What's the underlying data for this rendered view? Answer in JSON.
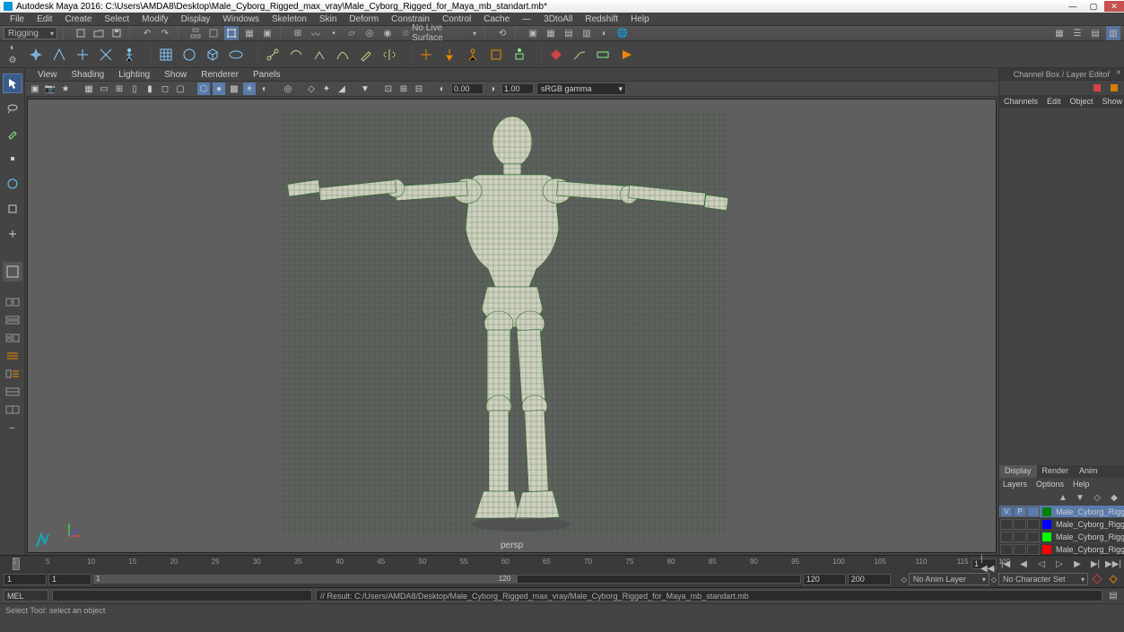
{
  "title": "Autodesk Maya 2016: C:\\Users\\AMDA8\\Desktop\\Male_Cyborg_Rigged_max_vray\\Male_Cyborg_Rigged_for_Maya_mb_standart.mb*",
  "menubar": [
    "File",
    "Edit",
    "Create",
    "Select",
    "Modify",
    "Display",
    "Windows",
    "Skeleton",
    "Skin",
    "Deform",
    "Constrain",
    "Control",
    "Cache",
    "—",
    "3DtoAll",
    "Redshift",
    "Help"
  ],
  "statusline": {
    "workspace": "Rigging",
    "livesurf": "No Live Surface"
  },
  "panelmenu": [
    "View",
    "Shading",
    "Lighting",
    "Show",
    "Renderer",
    "Panels"
  ],
  "viewtb": {
    "near": "0.00",
    "far": "1.00",
    "cm": "sRGB gamma"
  },
  "viewport": {
    "camera": "persp"
  },
  "channelbox": {
    "title": "Channel Box / Layer Editor",
    "tabs": [
      "Channels",
      "Edit",
      "Object",
      "Show"
    ]
  },
  "layers": {
    "tabs": [
      "Display",
      "Render",
      "Anim"
    ],
    "menu": [
      "Layers",
      "Options",
      "Help"
    ],
    "rows": [
      {
        "v": "V",
        "p": "P",
        "t": "",
        "color": "#007f00",
        "name": "Male_Cyborg_Rigged",
        "sel": true
      },
      {
        "v": "",
        "p": "",
        "t": "",
        "color": "#0000ff",
        "name": "Male_Cyborg_Rigged_"
      },
      {
        "v": "",
        "p": "",
        "t": "",
        "color": "#00ff00",
        "name": "Male_Cyborg_Rigged_"
      },
      {
        "v": "",
        "p": "",
        "t": "",
        "color": "#ff0000",
        "name": "Male_Cyborg_Rigged_"
      }
    ]
  },
  "timeslider": {
    "ticks": [
      1,
      5,
      10,
      15,
      20,
      25,
      30,
      35,
      40,
      45,
      50,
      55,
      60,
      65,
      70,
      75,
      80,
      85,
      90,
      95,
      100,
      105,
      110,
      115,
      120
    ],
    "current": "1"
  },
  "range": {
    "startAbs": "1",
    "start": "1",
    "end": "120",
    "endAbs": "200",
    "animlayer": "No Anim Layer",
    "charset": "No Character Set"
  },
  "cmd": {
    "lang": "MEL",
    "result": "// Result: C:/Users/AMDA8/Desktop/Male_Cyborg_Rigged_max_vray/Male_Cyborg_Rigged_for_Maya_mb_standart.mb"
  },
  "helpline": "Select Tool: select an object"
}
